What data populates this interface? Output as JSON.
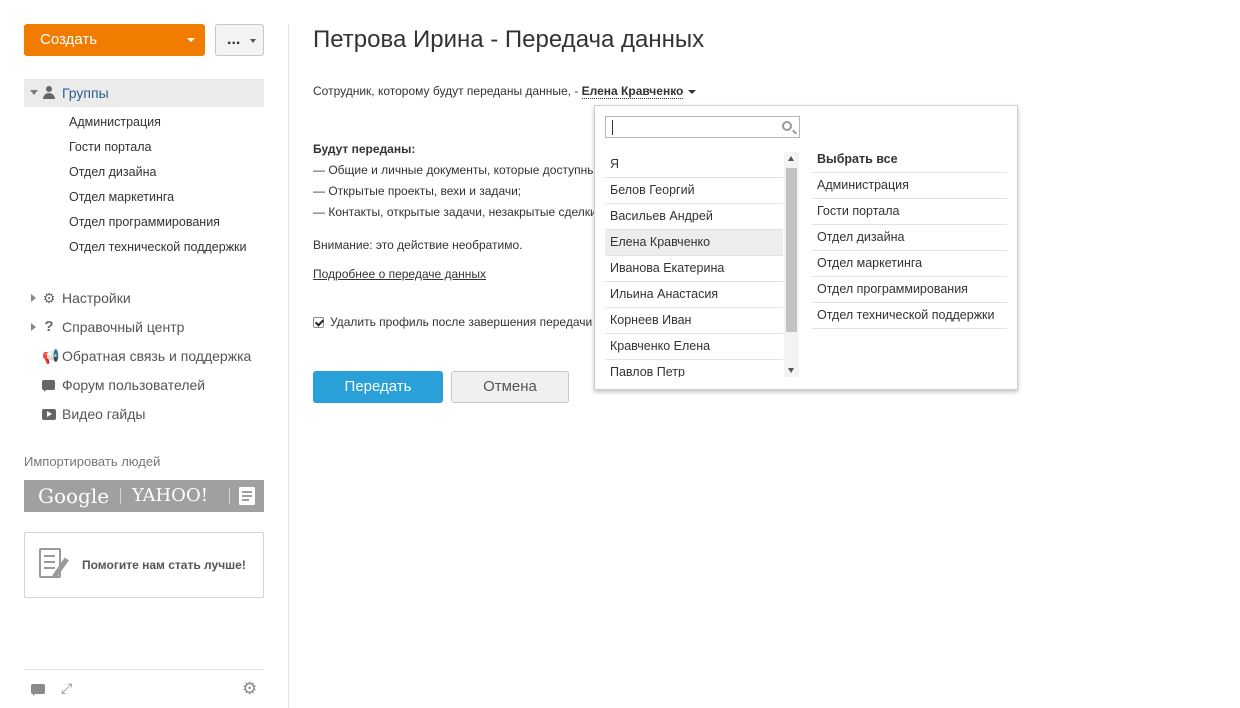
{
  "sidebar": {
    "create_label": "Создать",
    "more_label": "...",
    "groups_label": "Группы",
    "groups": [
      "Администрация",
      "Гости портала",
      "Отдел дизайна",
      "Отдел маркетинга",
      "Отдел программирования",
      "Отдел технической поддержки"
    ],
    "nav": {
      "settings": "Настройки",
      "help": "Справочный центр",
      "feedback": "Обратная связь и поддержка",
      "forum": "Форум пользователей",
      "video": "Видео гайды"
    },
    "import_label": "Импортировать людей",
    "import_google": "Google",
    "import_yahoo": "YAHOO!",
    "help_us_label": "Помогите нам стать лучше!"
  },
  "main": {
    "title": "Петрова Ирина - Передача данных",
    "recipient_prefix": "Сотрудник, которому будут переданы данные, - ",
    "recipient_value": "Елена Кравченко",
    "transfer_heading": "Будут переданы:",
    "transfer_items": [
      "—  Общие и личные документы, которые доступны другим пользователям;",
      "—  Открытые проекты, вехи и задачи;",
      "—  Контакты, открытые задачи, незакрытые сделки;"
    ],
    "warning": "Внимание: это действие необратимо.",
    "more_link": "Подробнее о передаче данных",
    "delete_profile_label": "Удалить профиль после завершения передачи",
    "transfer_button": "Передать",
    "cancel_button": "Отмена"
  },
  "popup": {
    "search_value": "",
    "users": [
      "Я",
      "Белов Георгий",
      "Васильев Андрей",
      "Елена Кравченко",
      "Иванова Екатерина",
      "Ильина Анастасия",
      "Корнеев Иван",
      "Кравченко Елена",
      "Павлов Петр"
    ],
    "highlighted_user": "Елена Кравченко",
    "select_all": "Выбрать все",
    "groups": [
      "Администрация",
      "Гости портала",
      "Отдел дизайна",
      "Отдел маркетинга",
      "Отдел программирования",
      "Отдел технической поддержки"
    ]
  },
  "colors": {
    "create_button": "#f27c00",
    "primary_button": "#2aa0d8",
    "groups_link": "#2a5b94"
  }
}
